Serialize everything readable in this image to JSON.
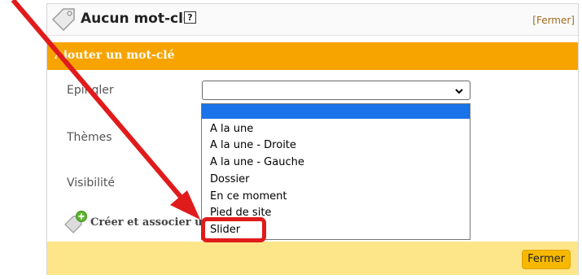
{
  "header": {
    "title": "Aucun mot-clé",
    "help_label": "?",
    "close_label": "[Fermer]"
  },
  "form": {
    "section_title": "Ajouter un mot-clé",
    "fields": [
      {
        "label": "Epingler"
      },
      {
        "label": "Thèmes"
      },
      {
        "label": "Visibilité"
      }
    ],
    "create_label": "Créer et associer u"
  },
  "dropdown": {
    "selected_value": "",
    "options": [
      "",
      "A la une",
      "A la une - Droite",
      "A la une - Gauche",
      "Dossier",
      "En ce moment",
      "Pied de site",
      "Slider"
    ]
  },
  "footer": {
    "button_label": "Fermer"
  },
  "colors": {
    "accent_orange": "#f7a400",
    "footer_yellow": "#fde68a",
    "highlight_blue": "#1a73e8",
    "annotation_red": "#e01b1b"
  }
}
